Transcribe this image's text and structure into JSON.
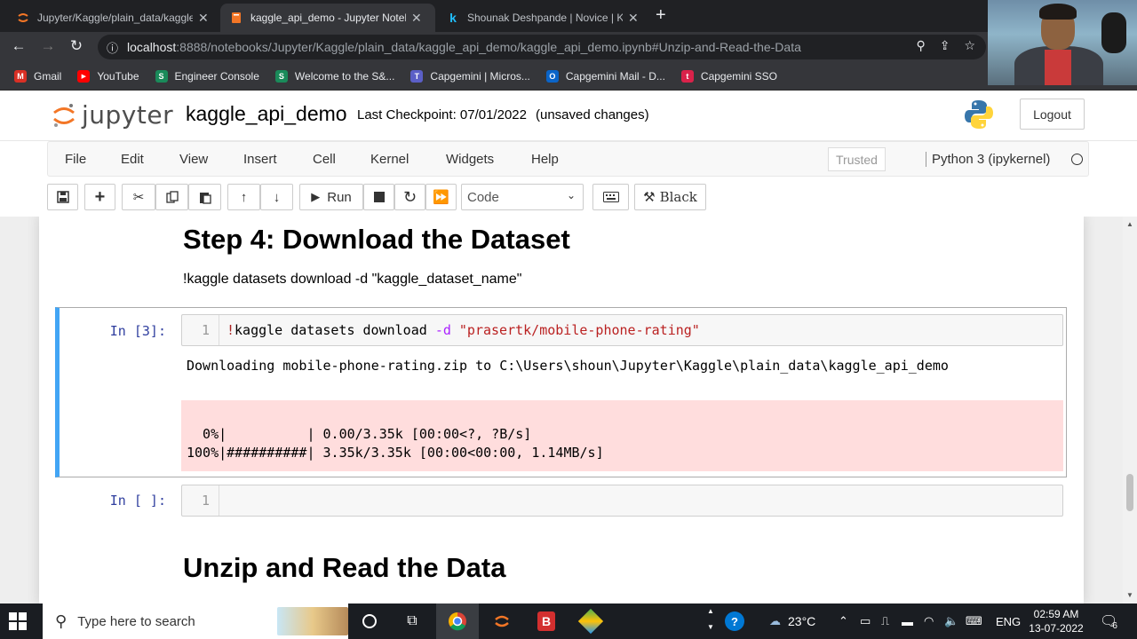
{
  "browser": {
    "tabs": [
      {
        "title": "Jupyter/Kaggle/plain_data/kaggle",
        "active": false
      },
      {
        "title": "kaggle_api_demo - Jupyter Noteb",
        "active": true
      },
      {
        "title": "Shounak Deshpande | Novice | Ka",
        "active": false
      }
    ],
    "url_host": "localhost",
    "url_rest": ":8888/notebooks/Jupyter/Kaggle/plain_data/kaggle_api_demo/kaggle_api_demo.ipynb#Unzip-and-Read-the-Data",
    "bookmarks": [
      {
        "label": "Gmail",
        "color": "#d93025",
        "glyph": "M"
      },
      {
        "label": "YouTube",
        "color": "#ff0000",
        "glyph": "▶"
      },
      {
        "label": "Engineer Console",
        "color": "#1a8a5a",
        "glyph": "S"
      },
      {
        "label": "Welcome to the S&...",
        "color": "#1a8a5a",
        "glyph": "S"
      },
      {
        "label": "Capgemini | Micros...",
        "color": "#5b5fc7",
        "glyph": "T"
      },
      {
        "label": "Capgemini Mail - D...",
        "color": "#0a64c8",
        "glyph": "O"
      },
      {
        "label": "Capgemini SSO",
        "color": "#d9224a",
        "glyph": "t"
      }
    ]
  },
  "jupyter": {
    "logo_text": "jupyter",
    "notebook_name": "kaggle_api_demo",
    "checkpoint": "Last Checkpoint: 07/01/2022",
    "unsaved": "(unsaved changes)",
    "logout": "Logout",
    "menu": [
      "File",
      "Edit",
      "View",
      "Insert",
      "Cell",
      "Kernel",
      "Widgets",
      "Help"
    ],
    "trusted": "Trusted",
    "kernel": "Python 3 (ipykernel)",
    "toolbar": {
      "run": "Run",
      "cell_type": "Code",
      "black": "Black"
    }
  },
  "notebook": {
    "heading1": "Step 4: Download the Dataset",
    "md_text": "!kaggle datasets download -d \"kaggle_dataset_name\"",
    "cell1": {
      "prompt": "In [3]:",
      "line": "1",
      "code_bang": "!",
      "code_cmd": "kaggle datasets download ",
      "code_flag": "-d",
      "code_str": "\"prasertk/mobile-phone-rating\"",
      "output": "Downloading mobile-phone-rating.zip to C:\\Users\\shoun\\Jupyter\\Kaggle\\plain_data\\kaggle_api_demo",
      "stderr_line1": "  0%|          | 0.00/3.35k [00:00<?, ?B/s]",
      "stderr_line2": "100%|##########| 3.35k/3.35k [00:00<00:00, 1.14MB/s]"
    },
    "cell2": {
      "prompt": "In [ ]:",
      "line": "1"
    },
    "heading2": "Unzip and Read the Data"
  },
  "taskbar": {
    "search_placeholder": "Type here to search",
    "weather": "23°C",
    "language": "ENG",
    "time": "02:59 AM",
    "date": "13-07-2022",
    "notifications": "6"
  }
}
